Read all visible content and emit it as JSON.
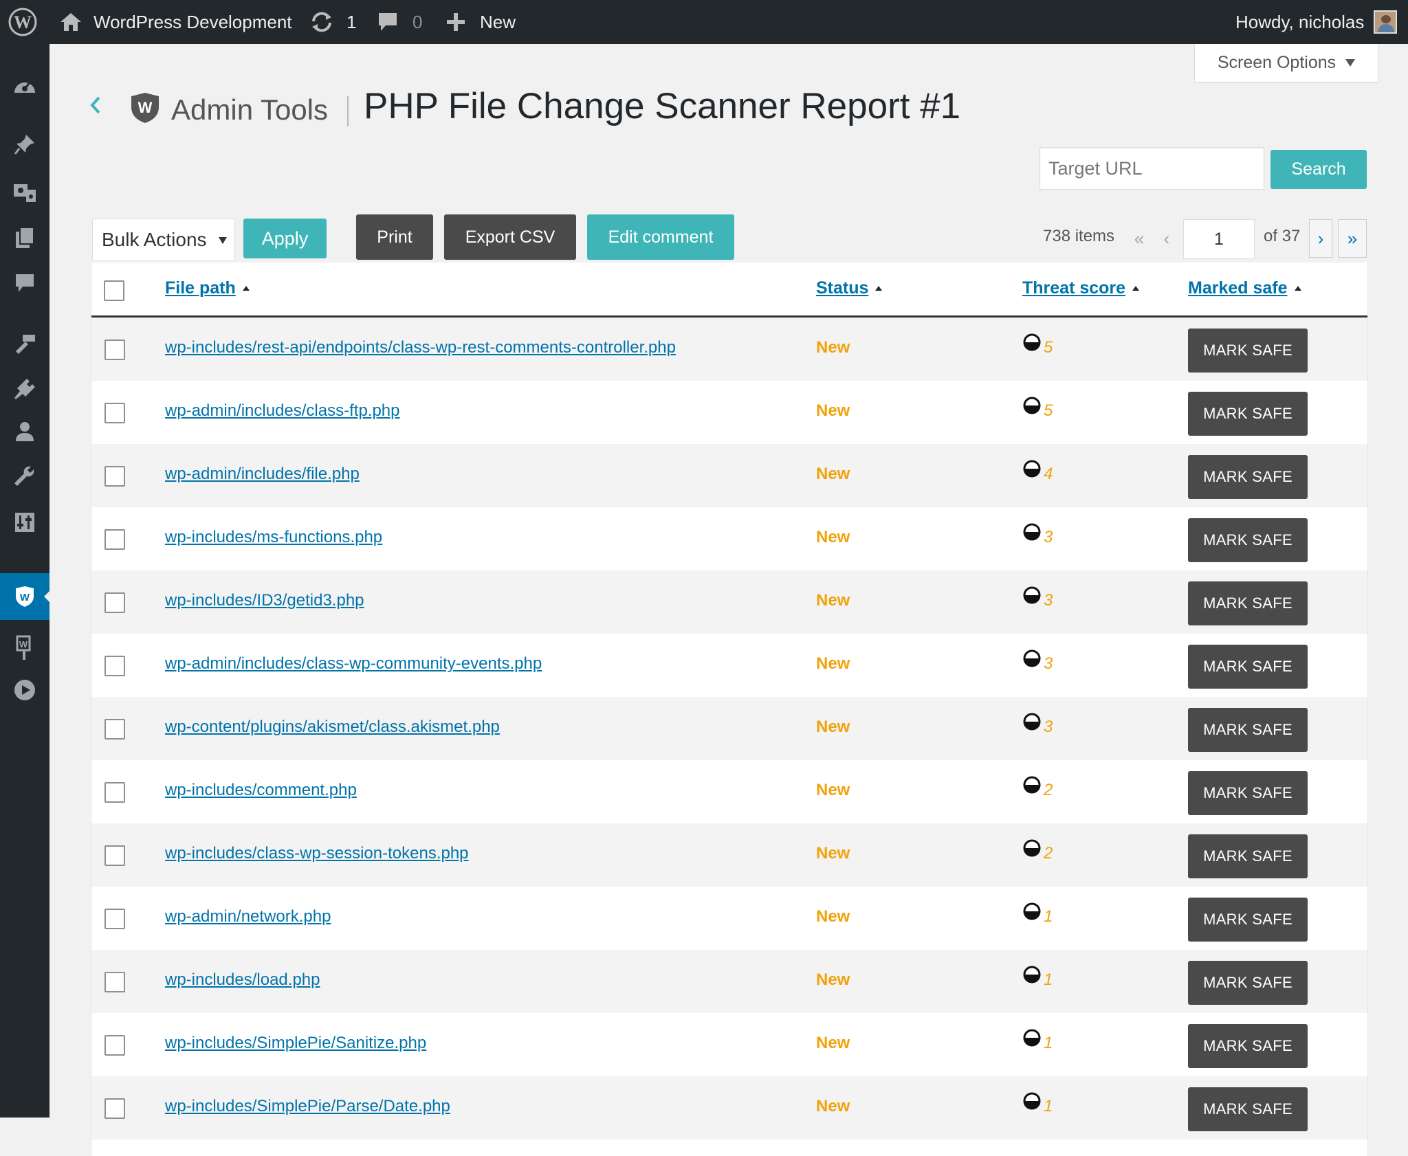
{
  "adminbar": {
    "site_name": "WordPress Development",
    "updates_count": "1",
    "comments_count": "0",
    "new_label": "New",
    "greeting": "Howdy, nicholas"
  },
  "screen_options": "Screen Options",
  "header": {
    "brand": "Admin Tools",
    "title": "PHP File Change Scanner Report #1"
  },
  "search": {
    "placeholder": "Target URL",
    "button": "Search"
  },
  "toolbar": {
    "bulk_actions": "Bulk Actions",
    "apply": "Apply",
    "print": "Print",
    "export_csv": "Export CSV",
    "edit_comment": "Edit comment"
  },
  "pagination": {
    "items": "738 items",
    "first": "«",
    "prev": "‹",
    "current": "1",
    "of": "of 37",
    "next": "›",
    "last": "»"
  },
  "table": {
    "columns": [
      "File path",
      "Status",
      "Threat score",
      "Marked safe"
    ],
    "action_label": "MARK SAFE",
    "rows": [
      {
        "path": "wp-includes/rest-api/endpoints/class-wp-rest-comments-controller.php",
        "status": "New",
        "score": "5"
      },
      {
        "path": "wp-admin/includes/class-ftp.php",
        "status": "New",
        "score": "5"
      },
      {
        "path": "wp-admin/includes/file.php",
        "status": "New",
        "score": "4"
      },
      {
        "path": "wp-includes/ms-functions.php",
        "status": "New",
        "score": "3"
      },
      {
        "path": "wp-includes/ID3/getid3.php",
        "status": "New",
        "score": "3"
      },
      {
        "path": "wp-admin/includes/class-wp-community-events.php",
        "status": "New",
        "score": "3"
      },
      {
        "path": "wp-content/plugins/akismet/class.akismet.php",
        "status": "New",
        "score": "3"
      },
      {
        "path": "wp-includes/comment.php",
        "status": "New",
        "score": "2"
      },
      {
        "path": "wp-includes/class-wp-session-tokens.php",
        "status": "New",
        "score": "2"
      },
      {
        "path": "wp-admin/network.php",
        "status": "New",
        "score": "1"
      },
      {
        "path": "wp-includes/load.php",
        "status": "New",
        "score": "1"
      },
      {
        "path": "wp-includes/SimplePie/Sanitize.php",
        "status": "New",
        "score": "1"
      },
      {
        "path": "wp-includes/SimplePie/Parse/Date.php",
        "status": "New",
        "score": "1"
      }
    ]
  },
  "colors": {
    "adminbar_bg": "#23282d",
    "accent_teal": "#40b5b8",
    "dark_button": "#4a4a4a",
    "link_blue": "#0073aa",
    "status_orange": "#f0a30a",
    "active_menu": "#0073aa"
  },
  "icons": {
    "adminbar": [
      "wordpress-logo-icon",
      "home-icon",
      "updates-icon",
      "comments-icon",
      "plus-icon",
      "avatar"
    ],
    "sidebar": [
      "dashboard-icon",
      "pin-icon",
      "media-icon",
      "pages-icon",
      "comments-icon",
      "appearance-icon",
      "plugins-icon",
      "users-icon",
      "tools-icon",
      "settings-icon",
      "admin-tools-shield-icon",
      "plugin-extra-icon",
      "play-icon"
    ],
    "threat": "half-circle-gauge-icon"
  }
}
